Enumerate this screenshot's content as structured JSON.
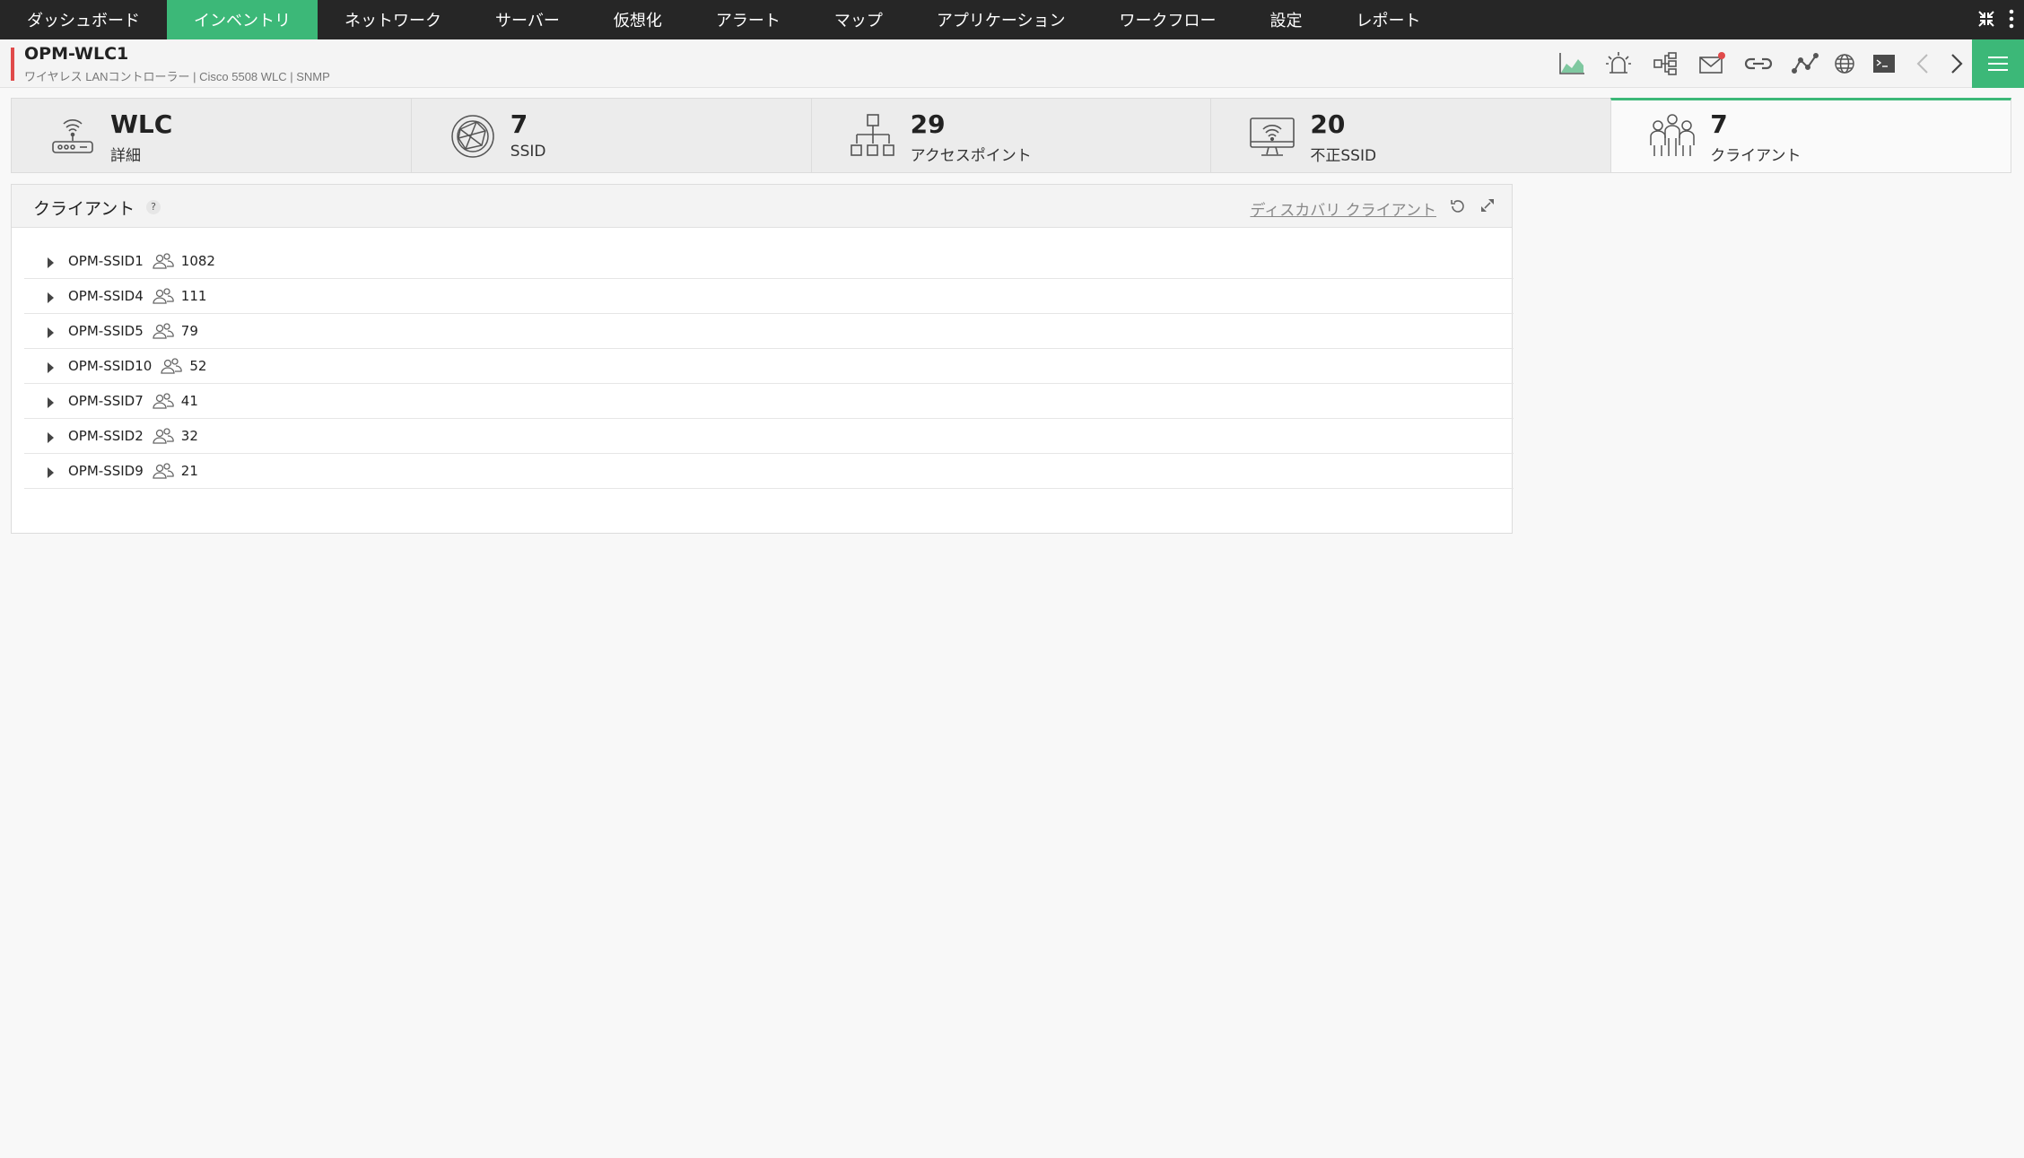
{
  "nav": {
    "tabs": [
      {
        "label": "ダッシュボード"
      },
      {
        "label": "インベントリ"
      },
      {
        "label": "ネットワーク"
      },
      {
        "label": "サーバー"
      },
      {
        "label": "仮想化"
      },
      {
        "label": "アラート"
      },
      {
        "label": "マップ"
      },
      {
        "label": "アプリケーション"
      },
      {
        "label": "ワークフロー"
      },
      {
        "label": "設定"
      },
      {
        "label": "レポート"
      }
    ],
    "active_tab": "インベントリ",
    "accent_color": "#3cb878"
  },
  "device": {
    "name": "OPM-WLC1",
    "subtitle": "ワイヤレス LANコントローラー | Cisco 5508 WLC  | SNMP"
  },
  "toolbar": {
    "icons": [
      "chart-icon",
      "alarm-icon",
      "hierarchy-icon",
      "mail-icon",
      "link-icon",
      "graph-icon",
      "globe-icon",
      "terminal-icon",
      "prev-icon",
      "next-icon"
    ]
  },
  "cards": [
    {
      "value": "WLC",
      "label": "詳細",
      "icon": "wlc-router-icon"
    },
    {
      "value": "7",
      "label": "SSID",
      "icon": "ssid-globe-icon"
    },
    {
      "value": "29",
      "label": "アクセスポイント",
      "icon": "access-point-icon"
    },
    {
      "value": "20",
      "label": "不正SSID",
      "icon": "rogue-ssid-icon"
    },
    {
      "value": "7",
      "label": "クライアント",
      "icon": "clients-icon"
    }
  ],
  "clients_panel": {
    "title": "クライアント",
    "help": "?",
    "discover_link": "ディスカバリ クライアント",
    "rows": [
      {
        "name": "OPM-SSID1",
        "count": "1082"
      },
      {
        "name": "OPM-SSID4",
        "count": "111"
      },
      {
        "name": "OPM-SSID5",
        "count": "79"
      },
      {
        "name": "OPM-SSID10",
        "count": "52"
      },
      {
        "name": "OPM-SSID7",
        "count": "41"
      },
      {
        "name": "OPM-SSID2",
        "count": "32"
      },
      {
        "name": "OPM-SSID9",
        "count": "21"
      }
    ]
  }
}
